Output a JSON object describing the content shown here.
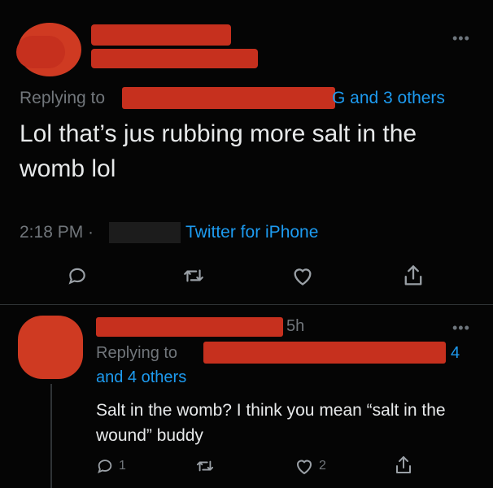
{
  "tweet": {
    "replying_prefix": "Replying to",
    "replying_suffix": "G and 3 others",
    "text": "Lol that’s jus rubbing more salt in the womb lol",
    "time": "2:18 PM ·",
    "client": "Twitter for iPhone"
  },
  "reply": {
    "time_fragment": "5h",
    "replying_prefix": "Replying to",
    "mention_suffix": "4",
    "others": "and 4 others",
    "text": "Salt in the womb? I think you mean “salt in the wound” buddy",
    "reply_count": "1",
    "like_count": "2"
  },
  "icons": {
    "more": "more-icon",
    "reply": "reply-icon",
    "retweet": "retweet-icon",
    "like": "like-icon",
    "share": "share-icon"
  },
  "colors": {
    "background": "#050505",
    "text": "#e7e9ea",
    "muted": "#71767b",
    "accent": "#1d9bf0",
    "redaction": "#c6301e"
  }
}
